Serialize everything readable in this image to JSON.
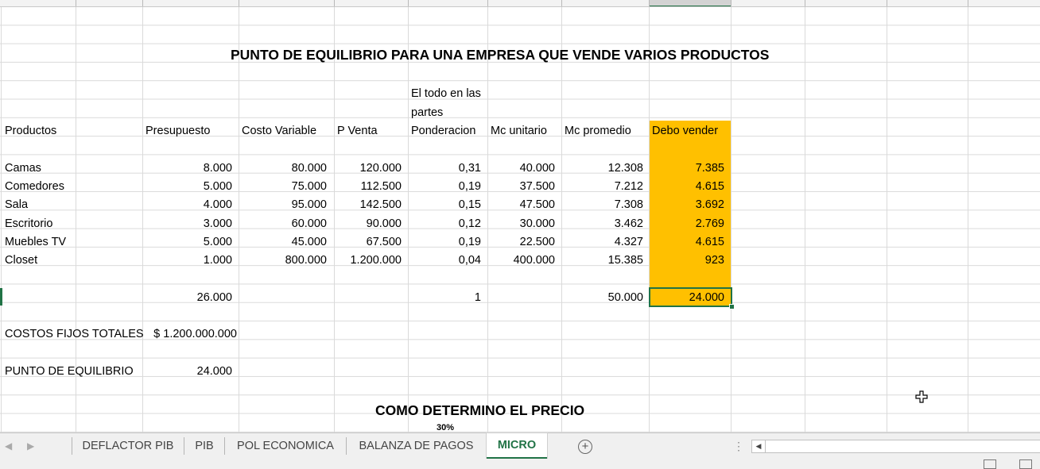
{
  "sheet": {
    "title": "PUNTO DE EQUILIBRIO PARA UNA EMPRESA QUE VENDE VARIOS PRODUCTOS",
    "note_line1": "El todo en las",
    "note_line2": "partes",
    "headers": {
      "productos": "Productos",
      "presupuesto": "Presupuesto",
      "costo_variable": "Costo Variable",
      "p_venta": "P Venta",
      "ponderacion": "Ponderacion",
      "mc_unitario": "Mc unitario",
      "mc_promedio": "Mc promedio",
      "debo_vender": "Debo vender"
    },
    "rows": [
      {
        "producto": "Camas",
        "presupuesto": "8.000",
        "costo_variable": "80.000",
        "p_venta": "120.000",
        "ponderacion": "0,31",
        "mc_unitario": "40.000",
        "mc_promedio": "12.308",
        "debo_vender": "7.385"
      },
      {
        "producto": "Comedores",
        "presupuesto": "5.000",
        "costo_variable": "75.000",
        "p_venta": "112.500",
        "ponderacion": "0,19",
        "mc_unitario": "37.500",
        "mc_promedio": "7.212",
        "debo_vender": "4.615"
      },
      {
        "producto": "Sala",
        "presupuesto": "4.000",
        "costo_variable": "95.000",
        "p_venta": "142.500",
        "ponderacion": "0,15",
        "mc_unitario": "47.500",
        "mc_promedio": "7.308",
        "debo_vender": "3.692"
      },
      {
        "producto": "Escritorio",
        "presupuesto": "3.000",
        "costo_variable": "60.000",
        "p_venta": "90.000",
        "ponderacion": "0,12",
        "mc_unitario": "30.000",
        "mc_promedio": "3.462",
        "debo_vender": "2.769"
      },
      {
        "producto": "Muebles TV",
        "presupuesto": "5.000",
        "costo_variable": "45.000",
        "p_venta": "67.500",
        "ponderacion": "0,19",
        "mc_unitario": "22.500",
        "mc_promedio": "4.327",
        "debo_vender": "4.615"
      },
      {
        "producto": "Closet",
        "presupuesto": "1.000",
        "costo_variable": "800.000",
        "p_venta": "1.200.000",
        "ponderacion": "0,04",
        "mc_unitario": "400.000",
        "mc_promedio": "15.385",
        "debo_vender": "923"
      }
    ],
    "totals": {
      "presupuesto": "26.000",
      "ponderacion": "1",
      "mc_promedio": "50.000",
      "debo_vender": "24.000"
    },
    "costos_fijos_label": "COSTOS FIJOS TOTALES",
    "costos_fijos_value": "$ 1.200.000.000",
    "punto_equilibrio_label": "PUNTO DE EQUILIBRIO",
    "punto_equilibrio_value": "24.000",
    "precio_title": "COMO DETERMINO EL PRECIO",
    "precio_partial": "30%"
  },
  "tabs": [
    "DEFLACTOR PIB",
    "PIB",
    "POL ECONOMICA",
    "BALANZA DE PAGOS",
    "MICRO"
  ],
  "active_tab": "MICRO",
  "colors": {
    "highlight": "#ffc000",
    "accent": "#217346"
  }
}
